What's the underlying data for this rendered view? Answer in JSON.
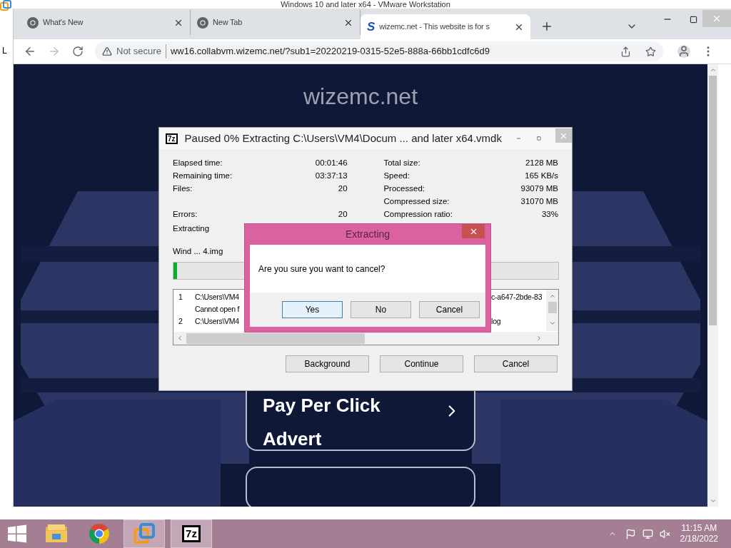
{
  "vm_window": {
    "title": "Windows 10 and later x64 - VMware Workstation",
    "side_text": "L"
  },
  "browser": {
    "tabs": [
      {
        "title": "What's New",
        "selected": false,
        "kind": "chrome"
      },
      {
        "title": "New Tab",
        "selected": false,
        "kind": "chrome"
      },
      {
        "title": "wizemc.net - This website is for s",
        "selected": true,
        "kind": "letter",
        "letter": "S"
      }
    ],
    "security": "Not secure",
    "url": "ww16.collabvm.wizemc.net/?sub1=20220219-0315-52e5-888a-66bb1cdfc6d9"
  },
  "page": {
    "heading": "wizemc.net",
    "card_title": "Pay Per Click",
    "card_subtitle": "Advert"
  },
  "progress_window": {
    "icon_text": "7z",
    "title": "Paused 0% Extracting C:\\Users\\VM4\\Docum ... and later x64.vmdk",
    "rows": [
      {
        "left": {
          "label": "Elapsed time:",
          "value": "00:01:46"
        },
        "right": {
          "label": "Total size:",
          "value": "2128 MB"
        }
      },
      {
        "left": {
          "label": "Remaining time:",
          "value": "03:37:13"
        },
        "right": {
          "label": "Speed:",
          "value": "165 KB/s"
        }
      },
      {
        "left": {
          "label": "Files:",
          "value": "20"
        },
        "right": {
          "label": "Processed:",
          "value": "93079 MB"
        }
      },
      {
        "right": {
          "label": "Compressed size:",
          "value": "31070 MB"
        }
      },
      {
        "left": {
          "label": "Errors:",
          "value": "20"
        },
        "right": {
          "label": "Compression ratio:",
          "value": "33%"
        }
      }
    ],
    "status": "Extracting",
    "current_file": "Wind ... 4.img",
    "progress": {
      "level": 0.01
    },
    "log": [
      {
        "number": "1",
        "path": "C:\\Users\\VM4",
        "tail": "c-a647-2bde-83",
        "message": "Cannot open f"
      },
      {
        "number": "2",
        "path": "C:\\Users\\VM4",
        "tail": "log"
      }
    ],
    "buttons": [
      "Background",
      "Continue",
      "Cancel"
    ]
  },
  "dialog": {
    "title": "Extracting",
    "message": "Are you sure you want to cancel?",
    "buttons": [
      {
        "label": "Yes",
        "focused": true
      },
      {
        "label": "No",
        "focused": false
      },
      {
        "label": "Cancel",
        "focused": false
      }
    ]
  },
  "taskbar": {
    "apps": [
      {
        "kind": "explorer",
        "active": false
      },
      {
        "kind": "chrome",
        "active": false
      },
      {
        "kind": "vmware",
        "active": true
      },
      {
        "kind": "sevenzip",
        "active": true,
        "label": "7z"
      }
    ],
    "time": "11:15 AM",
    "date": "2/18/2022"
  }
}
